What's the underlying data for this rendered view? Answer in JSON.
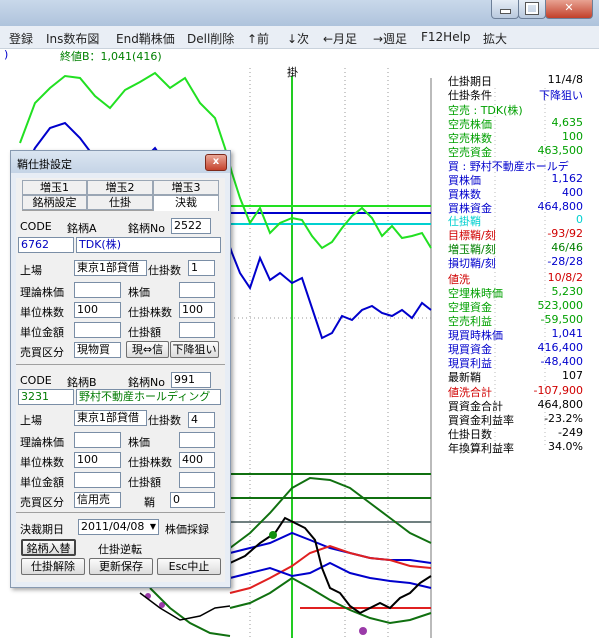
{
  "window": {
    "minimize_icon": "minimize-icon",
    "maximize_icon": "maximize-icon",
    "close_icon": "close-x-icon",
    "close_glyph": "✕"
  },
  "menu": {
    "items": [
      "登録",
      "Ins数布図",
      "End鞘株価",
      "Dell削除",
      "↑前",
      "↓次",
      "←月足",
      "→週足",
      "F12Help",
      "拡大"
    ]
  },
  "chart": {
    "header_label": "終値B：1,041(416)",
    "vline_label": "掛",
    "colors": {
      "green": "#22e022",
      "blue": "#0000cc",
      "dark_green": "#107010",
      "red": "#e02020",
      "cyan": "#00e0e0"
    }
  },
  "info_panel": {
    "rows": [
      {
        "label": "仕掛期日",
        "value": "11/4/8",
        "color": "#000000"
      },
      {
        "label": "仕掛条件",
        "value": "下降狙い",
        "color": "#000000",
        "value_color": "#0000cc"
      },
      {
        "label": "空売 : TDK(株)",
        "value": "",
        "color": "#00a000"
      },
      {
        "label": "空売株価",
        "value": "4,635",
        "color": "#00a000"
      },
      {
        "label": "空売株数",
        "value": "100",
        "color": "#00a000"
      },
      {
        "label": "空売資金",
        "value": "463,500",
        "color": "#00a000"
      },
      {
        "label": "買 : 野村不動産ホールデ",
        "value": "",
        "color": "#0000cc"
      },
      {
        "label": "買株価",
        "value": "1,162",
        "color": "#0000cc"
      },
      {
        "label": "買株数",
        "value": "400",
        "color": "#0000cc"
      },
      {
        "label": "買株資金",
        "value": "464,800",
        "color": "#0000cc"
      },
      {
        "label": "仕掛鞘",
        "value": "0",
        "color": "#00d0d0"
      },
      {
        "label": "目標鞘/刻",
        "value": "-93/92",
        "color": "#d00000"
      },
      {
        "label": "増玉鞘/刻",
        "value": "46/46",
        "color": "#008000"
      },
      {
        "label": "損切鞘/刻",
        "value": "-28/28",
        "color": "#0000cc"
      },
      {
        "label": "値洗",
        "value": "10/8/2",
        "color": "#d00000"
      },
      {
        "label": "空埋株時価",
        "value": "5,230",
        "color": "#00a000"
      },
      {
        "label": "空埋資金",
        "value": "523,000",
        "color": "#00a000"
      },
      {
        "label": "空売利益",
        "value": "-59,500",
        "color": "#00a000"
      },
      {
        "label": "現買時株価",
        "value": "1,041",
        "color": "#0000cc"
      },
      {
        "label": "現買資金",
        "value": "416,400",
        "color": "#0000cc"
      },
      {
        "label": "現買利益",
        "value": "-48,400",
        "color": "#0000cc"
      },
      {
        "label": "最新鞘",
        "value": "107",
        "color": "#000000"
      },
      {
        "label": "値洗合計",
        "value": "-107,900",
        "color": "#d00000"
      },
      {
        "label": "買資金合計",
        "value": "464,800",
        "color": "#000000"
      },
      {
        "label": "買資金利益率",
        "value": "-23.2%",
        "color": "#000000"
      },
      {
        "label": "仕掛日数",
        "value": "-249",
        "color": "#000000"
      },
      {
        "label": "年換算利益率",
        "value": "34.0%",
        "color": "#000000"
      }
    ]
  },
  "dialog": {
    "title": "鞘仕掛設定",
    "close_glyph": "x",
    "tabs_row1": [
      "増玉1",
      "増玉2",
      "増玉3"
    ],
    "tabs_row2": [
      "銘柄設定",
      "仕掛",
      "決裁"
    ],
    "active_tab": "決裁",
    "section_a": {
      "code_label": "CODE",
      "stock_label": "銘柄A",
      "no_label": "銘柄No",
      "no_value": "2522",
      "code_value": "6762",
      "name_value": "TDK(株)",
      "market_label": "上場",
      "market_value": "東京1部貸借",
      "lots_label": "仕掛数",
      "lots_value": "1",
      "theory_label": "理論株価",
      "price_label": "株価",
      "unit_shares_label": "単位株数",
      "unit_shares_value": "100",
      "open_shares_label": "仕掛株数",
      "open_shares_value": "100",
      "unit_amount_label": "単位金額",
      "open_amount_label": "仕掛額",
      "trade_label": "売買区分",
      "trade_value": "現物買",
      "swap_button": "現⇔信",
      "direction_button": "下降狙い"
    },
    "section_b": {
      "code_label": "CODE",
      "stock_label": "銘柄B",
      "no_label": "銘柄No",
      "no_value": "991",
      "code_value": "3231",
      "name_value": "野村不動産ホールディング",
      "market_label": "上場",
      "market_value": "東京1部貸借",
      "lots_label": "仕掛数",
      "lots_value": "4",
      "theory_label": "理論株価",
      "price_label": "株価",
      "unit_shares_label": "単位株数",
      "unit_shares_value": "100",
      "open_shares_label": "仕掛株数",
      "open_shares_value": "400",
      "unit_amount_label": "単位金額",
      "open_amount_label": "仕掛額",
      "trade_label": "売買区分",
      "trade_value": "信用売",
      "spread_label": "鞘",
      "spread_value": "0"
    },
    "settle_date_label": "決裁期日",
    "settle_date_value": "2011/04/08",
    "settle_dropdown_icon": "dropdown-arrow-icon",
    "settle_dropdown_glyph": "▼",
    "price_adopt_button": "株価採録",
    "stock_swap_button": "銘柄入替",
    "reverse_button": "仕掛逆転",
    "cancel_button": "仕掛解除",
    "update_save_button": "更新保存",
    "esc_button": "Esc中止"
  }
}
